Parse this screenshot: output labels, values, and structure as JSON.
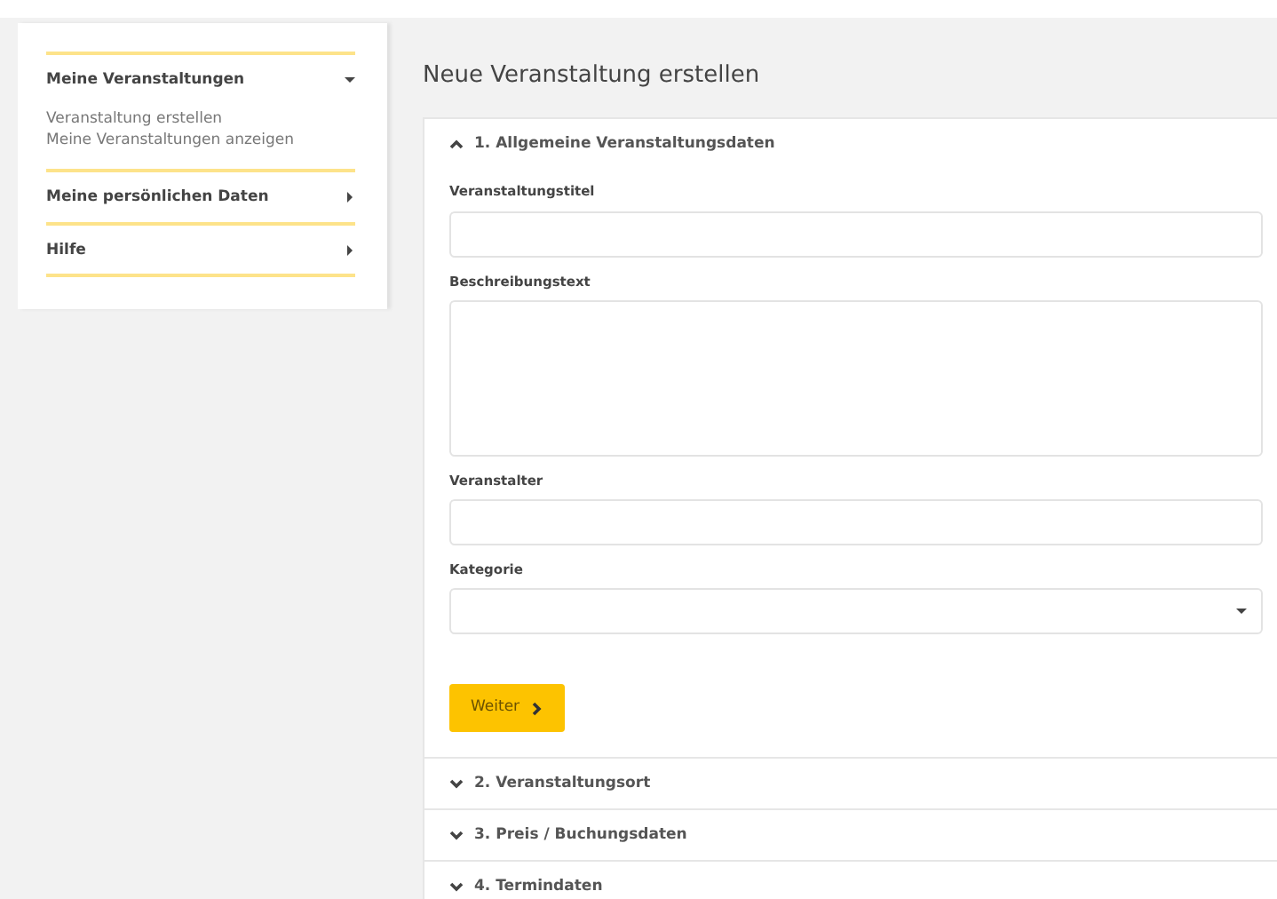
{
  "sidebar": {
    "items": [
      {
        "label": "Meine Veranstaltungen",
        "expanded": true,
        "children": [
          {
            "label": "Veranstaltung erstellen"
          },
          {
            "label": "Meine Veranstaltungen anzeigen"
          }
        ]
      },
      {
        "label": "Meine persönlichen Daten",
        "expanded": false
      },
      {
        "label": "Hilfe",
        "expanded": false
      }
    ]
  },
  "page_title": "Neue Veranstaltung erstellen",
  "sections": [
    {
      "title": "1. Allgemeine Veranstaltungsdaten",
      "expanded": true,
      "fields": [
        {
          "kind": "text",
          "label": "Veranstaltungstitel"
        },
        {
          "kind": "textarea",
          "label": "Beschreibungstext"
        },
        {
          "kind": "text",
          "label": "Veranstalter"
        },
        {
          "kind": "select",
          "label": "Kategorie"
        }
      ],
      "button": "Weiter"
    },
    {
      "title": "2. Veranstaltungsort",
      "expanded": false
    },
    {
      "title": "3. Preis / Buchungsdaten",
      "expanded": false
    },
    {
      "title": "4. Termindaten",
      "expanded": false
    }
  ]
}
